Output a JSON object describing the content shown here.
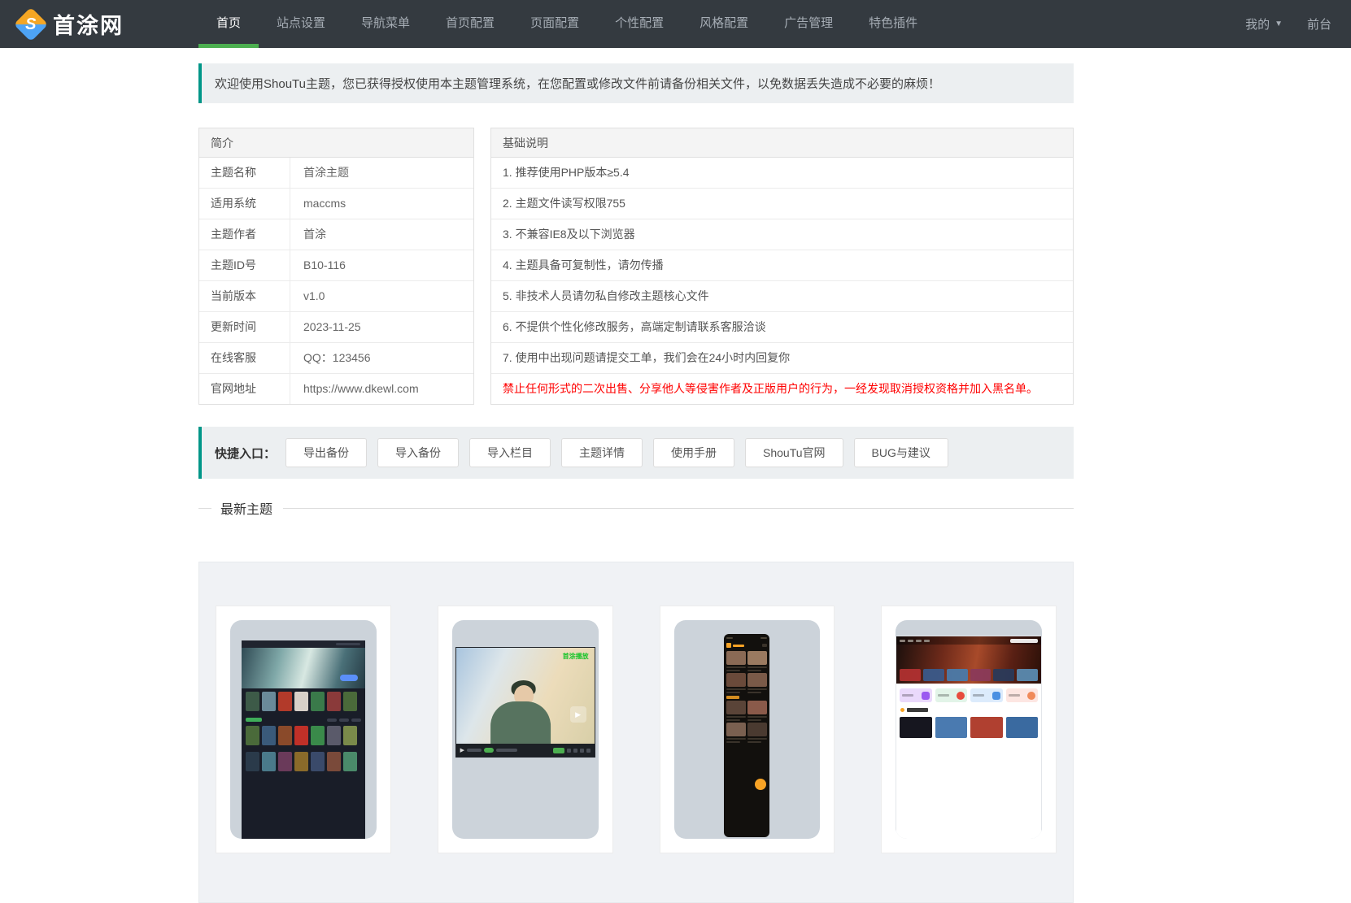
{
  "navbar": {
    "logo_text": "首涂网",
    "items": [
      {
        "label": "首页",
        "active": true
      },
      {
        "label": "站点设置",
        "active": false
      },
      {
        "label": "导航菜单",
        "active": false
      },
      {
        "label": "首页配置",
        "active": false
      },
      {
        "label": "页面配置",
        "active": false
      },
      {
        "label": "个性配置",
        "active": false
      },
      {
        "label": "风格配置",
        "active": false
      },
      {
        "label": "广告管理",
        "active": false
      },
      {
        "label": "特色插件",
        "active": false
      }
    ],
    "right": {
      "my_label": "我的",
      "front_label": "前台"
    }
  },
  "alert": {
    "text": "欢迎使用ShouTu主题，您已获得授权使用本主题管理系统，在您配置或修改文件前请备份相关文件，以免数据丢失造成不必要的麻烦！"
  },
  "intro_table": {
    "header": "简介",
    "rows": [
      {
        "label": "主题名称",
        "value": "首涂主题"
      },
      {
        "label": "适用系统",
        "value": "maccms"
      },
      {
        "label": "主题作者",
        "value": "首涂"
      },
      {
        "label": "主题ID号",
        "value": "B10-116"
      },
      {
        "label": "当前版本",
        "value": "v1.0"
      },
      {
        "label": "更新时间",
        "value": "2023-11-25"
      },
      {
        "label": "在线客服",
        "value": "QQ：123456"
      },
      {
        "label": "官网地址",
        "value": "https://www.dkewl.com"
      }
    ]
  },
  "notes_table": {
    "header": "基础说明",
    "rows": [
      "1. 推荐使用PHP版本≥5.4",
      "2. 主题文件读写权限755",
      "3. 不兼容IE8及以下浏览器",
      "4. 主题具备可复制性，请勿传播",
      "5. 非技术人员请勿私自修改主题核心文件",
      "6. 不提供个性化修改服务，高端定制请联系客服洽谈",
      "7. 使用中出现问题请提交工单，我们会在24小时内回复你"
    ],
    "warning": "禁止任何形式的二次出售、分享他人等侵害作者及正版用户的行为，一经发现取消授权资格并加入黑名单。"
  },
  "quick_entry": {
    "label": "快捷入口：",
    "buttons": [
      "导出备份",
      "导入备份",
      "导入栏目",
      "主题详情",
      "使用手册",
      "ShouTu官网",
      "BUG与建议"
    ]
  },
  "latest_section": {
    "title": "最新主题",
    "watermark": "首涂播放"
  },
  "colors": {
    "navbar_bg": "#343a40",
    "accent_green": "#4caf50",
    "accent_teal": "#009688",
    "alert_bg": "#eceff1",
    "warning_red": "#ff0000",
    "card_thumb_bg": "#ccd3da"
  }
}
